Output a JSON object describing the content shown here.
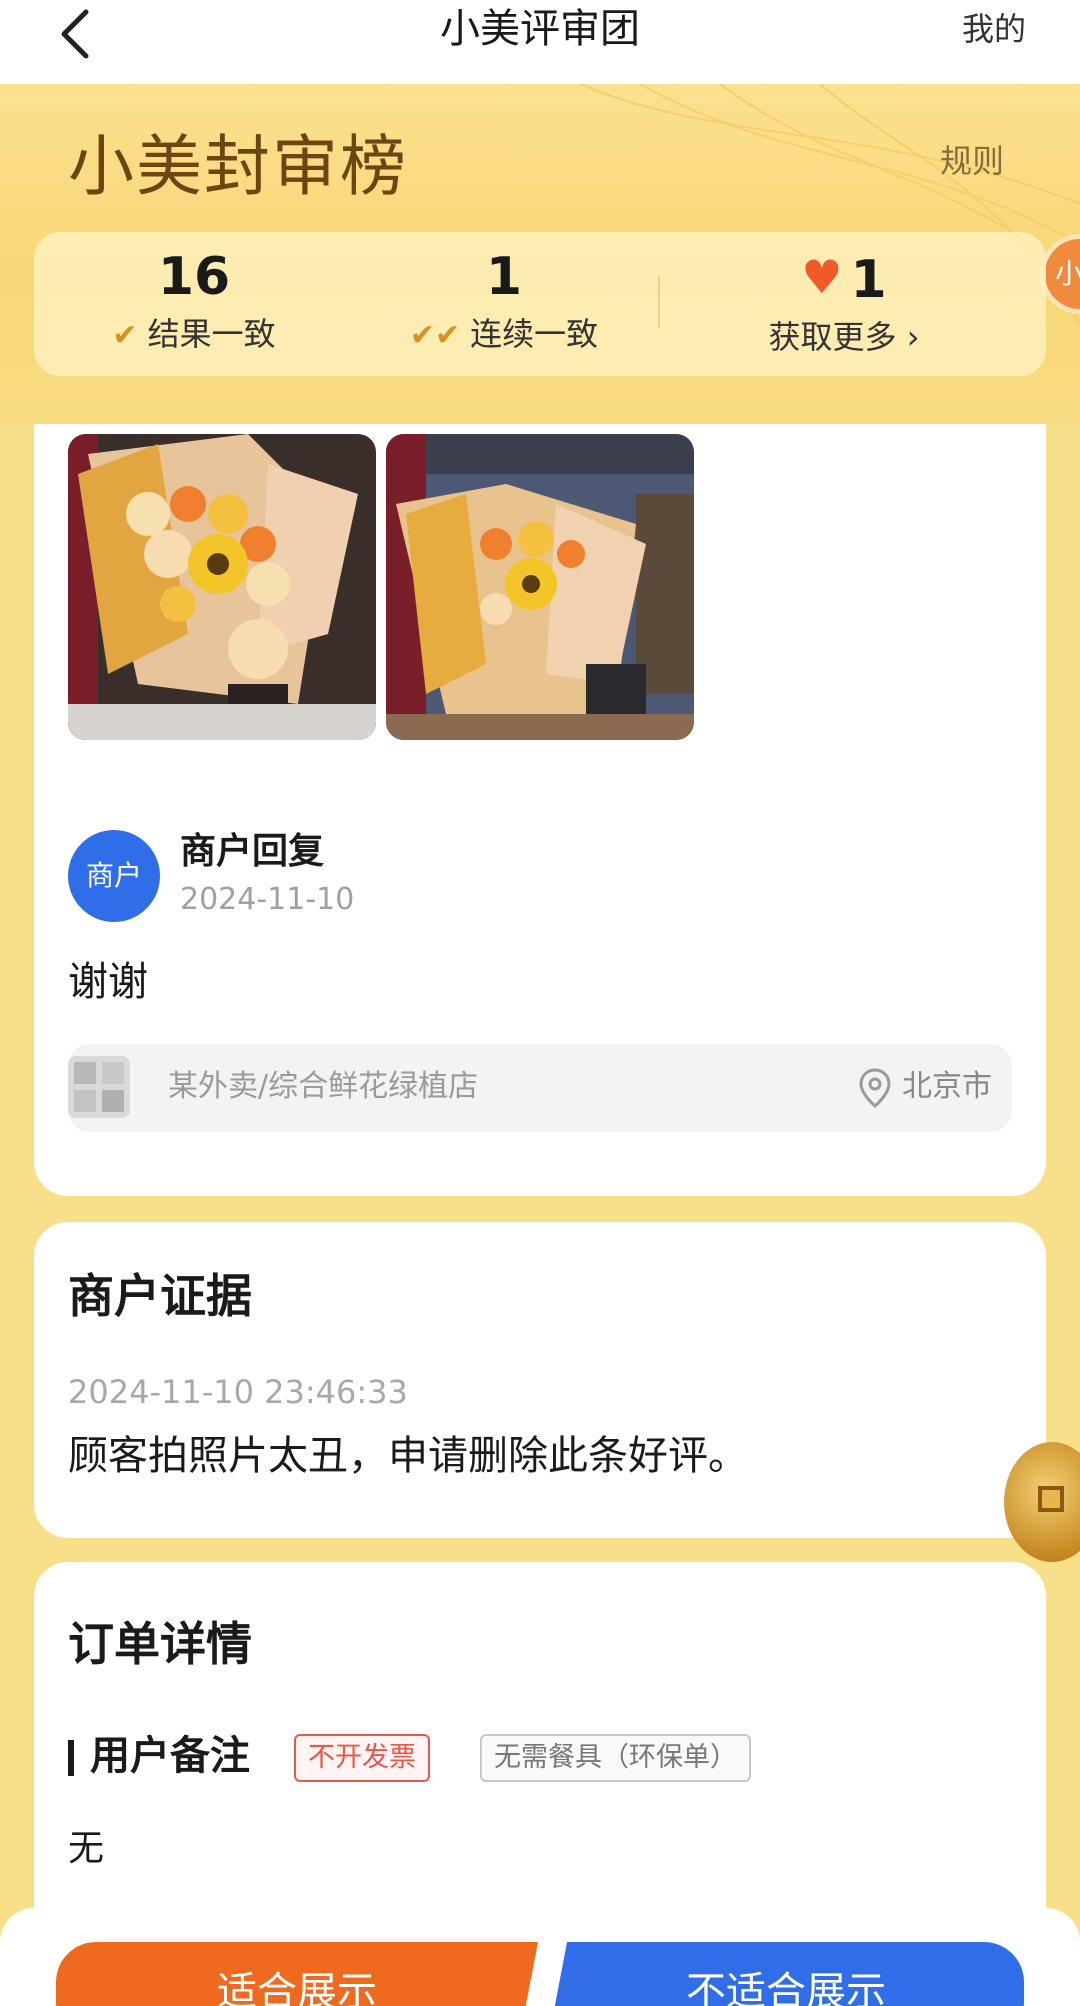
{
  "nav": {
    "title": "小美评审团",
    "mine": "我的"
  },
  "header": {
    "brand": "小美封审榜",
    "rules": "规则",
    "side_badge": "小",
    "stats": [
      {
        "value": "16",
        "label": "结果一致",
        "icon": "check-icon"
      },
      {
        "value": "1",
        "label": "连续一致",
        "icon": "double-check-icon"
      },
      {
        "value": "1",
        "label": "获取更多",
        "icon": "heart-icon"
      }
    ]
  },
  "review": {
    "photos": [
      "bouquet-photo-1",
      "bouquet-photo-2"
    ],
    "merchant_avatar": "商户",
    "reply_title": "商户回复",
    "reply_date": "2024-11-10",
    "reply_text": "谢谢",
    "shop_name": "某外卖/综合鲜花绿植店",
    "shop_city": "北京市"
  },
  "evidence": {
    "title": "商户证据",
    "time": "2024-11-10 23:46:33",
    "text": "顾客拍照片太丑，申请删除此条好评。"
  },
  "order": {
    "title": "订单详情",
    "remark_title": "用户备注",
    "tags": [
      "不开发票",
      "无需餐具（环保单）"
    ],
    "remark_value": "无"
  },
  "actions": {
    "fit": "适合展示",
    "unfit": "不适合展示"
  },
  "colors": {
    "gold": "#f8dc82",
    "brand_brown": "#6b4512",
    "orange": "#ef6a1f",
    "blue": "#2f6ee8",
    "tag_red": "#e8574a"
  }
}
